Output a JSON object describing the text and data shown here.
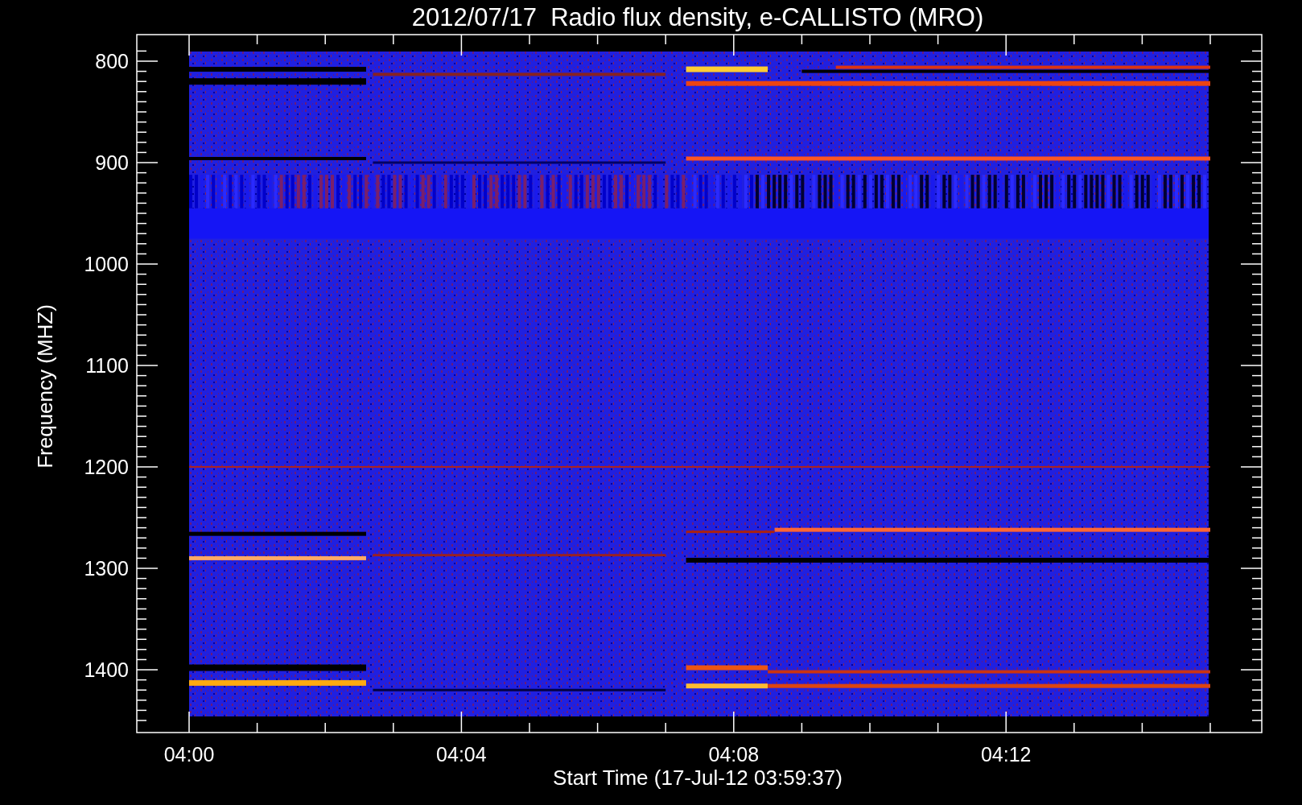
{
  "title": "2012/07/17  Radio flux density, e-CALLISTO (MRO)",
  "y_axis": {
    "label": "Frequency (MHZ)",
    "ticks": [
      "800",
      "900",
      "1000",
      "1100",
      "1200",
      "1300",
      "1400"
    ]
  },
  "x_axis": {
    "label": "Start Time (17-Jul-12 03:59:37)",
    "ticks": [
      "04:00",
      "04:04",
      "04:08",
      "04:12"
    ]
  }
}
